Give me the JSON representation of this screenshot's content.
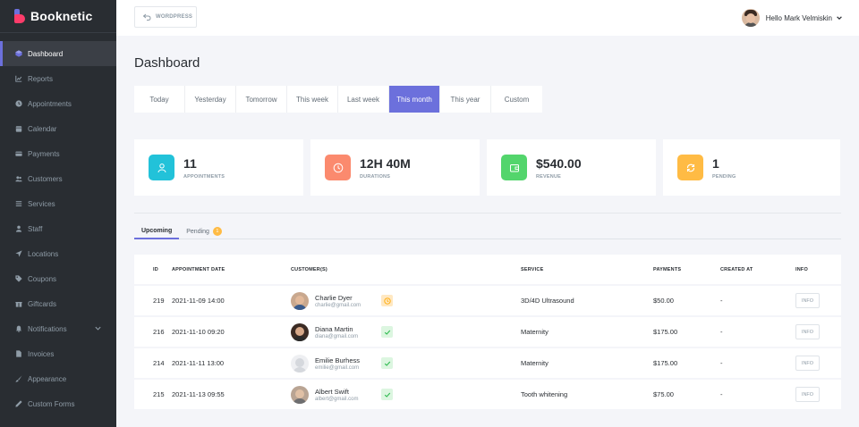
{
  "app": {
    "name": "Booknetic"
  },
  "sidebar": {
    "items": [
      {
        "label": "Dashboard",
        "icon": "cube-icon",
        "active": true
      },
      {
        "label": "Reports",
        "icon": "chart-icon"
      },
      {
        "label": "Appointments",
        "icon": "clock-icon"
      },
      {
        "label": "Calendar",
        "icon": "calendar-icon"
      },
      {
        "label": "Payments",
        "icon": "credit-card-icon"
      },
      {
        "label": "Customers",
        "icon": "users-icon"
      },
      {
        "label": "Services",
        "icon": "list-icon"
      },
      {
        "label": "Staff",
        "icon": "user-icon"
      },
      {
        "label": "Locations",
        "icon": "location-arrow-icon"
      },
      {
        "label": "Coupons",
        "icon": "tag-icon"
      },
      {
        "label": "Giftcards",
        "icon": "gift-icon"
      },
      {
        "label": "Notifications",
        "icon": "bell-icon"
      },
      {
        "label": "Invoices",
        "icon": "file-icon"
      },
      {
        "label": "Appearance",
        "icon": "brush-icon"
      },
      {
        "label": "Custom Forms",
        "icon": "pen-icon"
      }
    ]
  },
  "topbar": {
    "wordpress_label": "WORDPRESS",
    "user_greeting": "Hello Mark Velmiskin"
  },
  "page": {
    "title": "Dashboard"
  },
  "filters": [
    "Today",
    "Yesterday",
    "Tomorrow",
    "This week",
    "Last week",
    "This month",
    "This year",
    "Custom"
  ],
  "active_filter": "This month",
  "stats": [
    {
      "value": "11",
      "label": "APPOINTMENTS",
      "color": "#22c2d9",
      "icon": "user-icon"
    },
    {
      "value": "12H 40M",
      "label": "DURATIONS",
      "color": "#fb8a6e",
      "icon": "clock-icon"
    },
    {
      "value": "$540.00",
      "label": "REVENUE",
      "color": "#53d56c",
      "icon": "wallet-icon"
    },
    {
      "value": "1",
      "label": "PENDING",
      "color": "#ffbb44",
      "icon": "refresh-icon"
    }
  ],
  "tabs": {
    "upcoming": "Upcoming",
    "pending": "Pending",
    "pending_count": "1"
  },
  "table": {
    "headers": {
      "id": "ID",
      "date": "APPOINTMENT DATE",
      "customer": "CUSTOMER(S)",
      "service": "SERVICE",
      "payments": "PAYMENTS",
      "created": "CREATED AT",
      "info": "INFO"
    },
    "rows": [
      {
        "id": "219",
        "date": "2021-11-09 14:00",
        "name": "Charlie Dyer",
        "email": "charlie@gmail.com",
        "status": "pending",
        "service": "3D/4D Ultrasound",
        "payment": "$50.00",
        "created": "-",
        "info": "INFO"
      },
      {
        "id": "216",
        "date": "2021-11-10 09:20",
        "name": "Diana Martin",
        "email": "diana@gmail.com",
        "status": "approved",
        "service": "Maternity",
        "payment": "$175.00",
        "created": "-",
        "info": "INFO"
      },
      {
        "id": "214",
        "date": "2021-11-11 13:00",
        "name": "Emilie Burhess",
        "email": "emilie@gmail.com",
        "status": "approved",
        "service": "Maternity",
        "payment": "$175.00",
        "created": "-",
        "info": "INFO"
      },
      {
        "id": "215",
        "date": "2021-11-13 09:55",
        "name": "Albert Swift",
        "email": "albert@gmail.com",
        "status": "approved",
        "service": "Tooth whitening",
        "payment": "$75.00",
        "created": "-",
        "info": "INFO"
      }
    ]
  },
  "colors": {
    "accent": "#6c70dc",
    "sidebar_bg": "#292d32",
    "pending": "#ffbb44",
    "approved": "#53d56c"
  }
}
